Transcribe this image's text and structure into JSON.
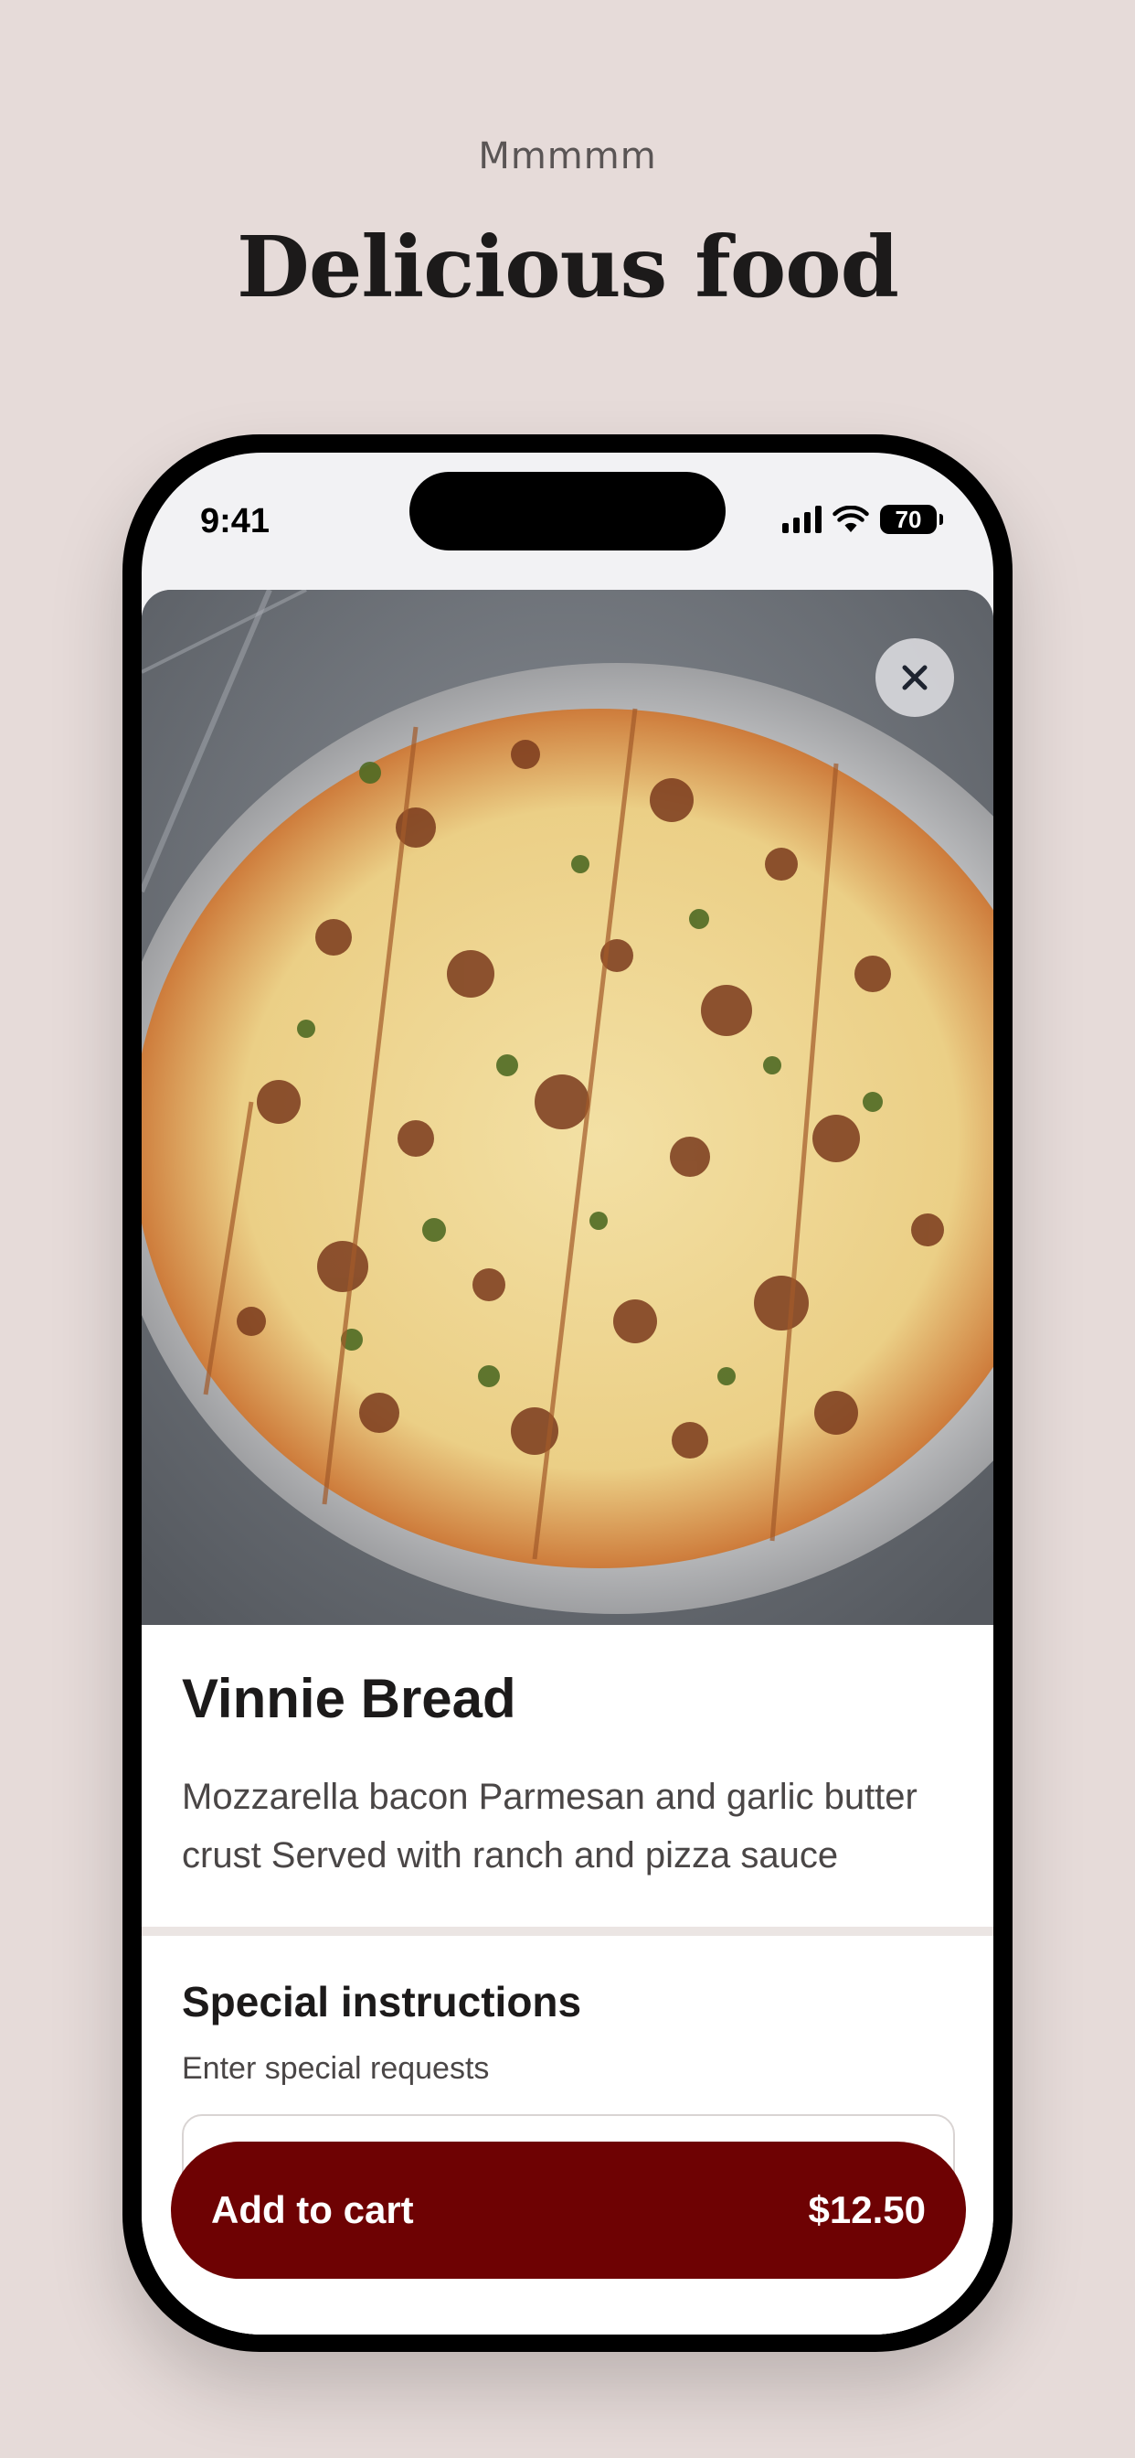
{
  "header": {
    "eyebrow": "Mmmmm",
    "title": "Delicious food"
  },
  "status_bar": {
    "time": "9:41",
    "battery": "70",
    "icons": [
      "signal-icon",
      "wifi-icon",
      "battery-icon"
    ]
  },
  "item": {
    "image": "pizza-bread-photo",
    "name": "Vinnie Bread",
    "description": "Mozzarella bacon Parmesan and garlic butter crust Served with ranch and pizza sauce"
  },
  "special_instructions": {
    "title": "Special instructions",
    "subtitle": "Enter special requests",
    "value": ""
  },
  "cart_button": {
    "label": "Add to cart",
    "price": "$12.50"
  },
  "colors": {
    "background": "#e6dbd9",
    "accent": "#6e0203",
    "text": "#1c1a1a"
  }
}
